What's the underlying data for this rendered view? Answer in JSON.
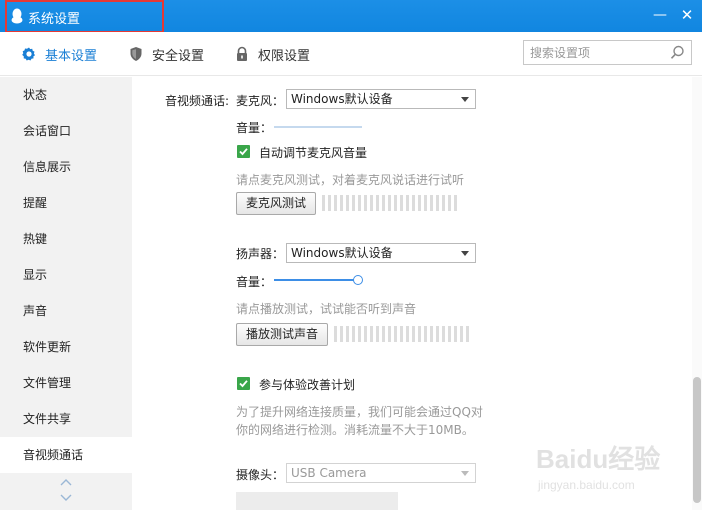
{
  "window": {
    "title": "系统设置",
    "minimize_glyph": "—",
    "close_glyph": "✕"
  },
  "tabs": [
    {
      "label": "基本设置",
      "icon": "gear-icon",
      "active": true
    },
    {
      "label": "安全设置",
      "icon": "shield-icon",
      "active": false
    },
    {
      "label": "权限设置",
      "icon": "lock-icon",
      "active": false
    }
  ],
  "search": {
    "placeholder": "搜索设置项",
    "value": ""
  },
  "sidebar": {
    "items": [
      {
        "label": "状态"
      },
      {
        "label": "会话窗口"
      },
      {
        "label": "信息展示"
      },
      {
        "label": "提醒"
      },
      {
        "label": "热键"
      },
      {
        "label": "显示"
      },
      {
        "label": "声音"
      },
      {
        "label": "软件更新"
      },
      {
        "label": "文件管理"
      },
      {
        "label": "文件共享"
      },
      {
        "label": "音视频通话",
        "active": true
      }
    ]
  },
  "av": {
    "section_label": "音视频通话:",
    "mic": {
      "label": "麦克风：",
      "device": "Windows默认设备",
      "volume_label": "音量：",
      "volume_level": 0,
      "auto_adjust_label": "自动调节麦克风音量",
      "auto_adjust_checked": true,
      "hint": "请点麦克风测试，对着麦克风说话进行试听",
      "test_button": "麦克风测试"
    },
    "speaker": {
      "label": "扬声器：",
      "device": "Windows默认设备",
      "volume_label": "音量：",
      "volume_level": 1.0,
      "hint": "请点播放测试，试试能否听到声音",
      "test_button": "播放测试声音"
    },
    "improve": {
      "label": "参与体验改善计划",
      "checked": true,
      "desc_line1": "为了提升网络连接质量，我们可能会通过QQ对",
      "desc_line2": "你的网络进行检测。消耗流量不大于10MB。"
    },
    "camera": {
      "label": "摄像头：",
      "device": "USB Camera"
    }
  },
  "colors": {
    "titlebar": "#1586e0",
    "accent": "#1a7fd5",
    "checkbox": "#3aa64a",
    "highlight_box": "#e53935"
  },
  "watermark": {
    "brand": "Baidu经验",
    "url": "jingyan.baidu.com"
  }
}
